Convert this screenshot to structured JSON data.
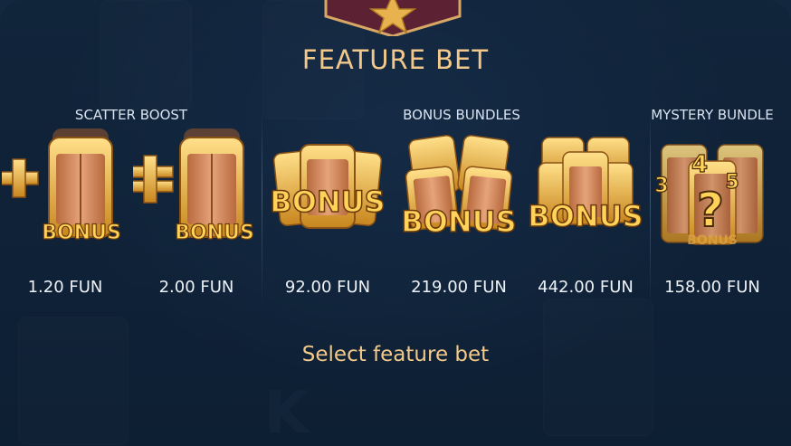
{
  "title": "FEATURE BET",
  "groups": {
    "scatter_boost": "SCATTER BOOST",
    "bonus_bundles": "BONUS BUNDLES",
    "mystery_bundle": "MYSTERY BUNDLE"
  },
  "items": [
    {
      "name": "scatter-boost-1",
      "price": "1.20 FUN",
      "icon": "plus-one-bonus-chest-icon",
      "label": "BONUS"
    },
    {
      "name": "scatter-boost-2",
      "price": "2.00 FUN",
      "icon": "plus-double-bonus-chest-icon",
      "label": "BONUS"
    },
    {
      "name": "bonus-bundle-1",
      "price": "92.00 FUN",
      "icon": "bonus-chest-bundle-icon",
      "label": "BONUS"
    },
    {
      "name": "bonus-bundle-2",
      "price": "219.00 FUN",
      "icon": "bonus-chest-bundle-icon",
      "label": "BONUS"
    },
    {
      "name": "bonus-bundle-3",
      "price": "442.00 FUN",
      "icon": "bonus-chest-bundle-icon",
      "label": "BONUS"
    },
    {
      "name": "mystery-bundle",
      "price": "158.00 FUN",
      "icon": "mystery-bundle-icon",
      "label": "BONUS",
      "mystery_numbers": [
        "3",
        "4",
        "5"
      ],
      "mystery_symbol": "?"
    }
  ],
  "footer": {
    "select_text": "Select feature bet"
  },
  "colors": {
    "gold": "#f2c98a",
    "background": "#0f2338",
    "badge": "#6e2a3a"
  }
}
